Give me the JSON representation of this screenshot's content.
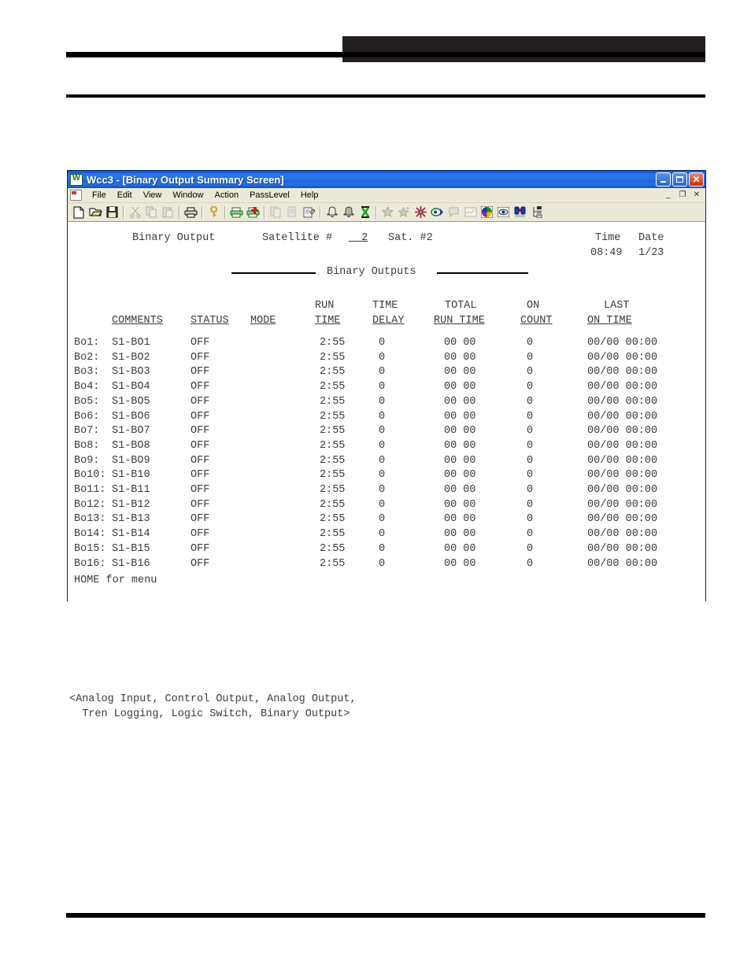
{
  "page": {
    "header_band_color": "#231f20",
    "rule_color": "#000000"
  },
  "window": {
    "title": "Wcc3 - [Binary Output Summary Screen]",
    "title_icon": "app-w-icon",
    "buttons": {
      "minimize": "_",
      "maximize": "□",
      "close": "✕"
    },
    "mdi_buttons": {
      "minimize": "_",
      "restore": "❐",
      "close": "✕"
    }
  },
  "menu": {
    "doc_icon": "document-icon",
    "items": [
      {
        "label": "File"
      },
      {
        "label": "Edit"
      },
      {
        "label": "View"
      },
      {
        "label": "Window"
      },
      {
        "label": "Action"
      },
      {
        "label": "PassLevel"
      },
      {
        "label": "Help"
      }
    ]
  },
  "toolbar": {
    "icons": [
      "new-document-icon",
      "open-folder-icon",
      "save-disk-icon",
      "cut-scissors-icon",
      "copy-icon",
      "paste-icon",
      "print-icon",
      "help-key-icon",
      "print-preview-icon",
      "print-report-icon",
      "copy-page-icon",
      "paste-page-icon",
      "edit-note-icon",
      "alarm-bell-icon",
      "alarm-bell-filled-icon",
      "hourglass-icon",
      "star-icon",
      "star-sparkle-icon",
      "firework-icon",
      "scan-eye-icon",
      "speech-bubble-icon",
      "trend-chart-icon",
      "pie-chart-icon",
      "eye-icon",
      "binoculars-icon",
      "tree-view-icon"
    ]
  },
  "screen": {
    "header": {
      "page_label": "Binary Output",
      "satellite_label": "Satellite #",
      "satellite_value": "__2",
      "sat_short": "Sat. #2",
      "time_label": "Time",
      "date_label": "Date",
      "time_value": "08:49",
      "date_value": "1/23",
      "section_title": "Binary Outputs"
    },
    "columns": {
      "top": [
        "",
        "",
        "",
        "RUN",
        "TIME",
        "TOTAL",
        "ON",
        "LAST"
      ],
      "bottom": [
        "COMMENTS",
        "STATUS",
        "MODE",
        "TIME",
        "DELAY",
        "RUN TIME",
        "COUNT",
        "ON TIME"
      ]
    },
    "rows": [
      {
        "id": "Bo1:",
        "comments": "S1-BO1",
        "status": "OFF",
        "mode": "",
        "run_time": "2:55",
        "time_delay": "0",
        "total_run_time": "00 00",
        "on_count": "0",
        "last_on_time": "00/00 00:00"
      },
      {
        "id": "Bo2:",
        "comments": "S1-BO2",
        "status": "OFF",
        "mode": "",
        "run_time": "2:55",
        "time_delay": "0",
        "total_run_time": "00 00",
        "on_count": "0",
        "last_on_time": "00/00 00:00"
      },
      {
        "id": "Bo3:",
        "comments": "S1-BO3",
        "status": "OFF",
        "mode": "",
        "run_time": "2:55",
        "time_delay": "0",
        "total_run_time": "00 00",
        "on_count": "0",
        "last_on_time": "00/00 00:00"
      },
      {
        "id": "Bo4:",
        "comments": "S1-BO4",
        "status": "OFF",
        "mode": "",
        "run_time": "2:55",
        "time_delay": "0",
        "total_run_time": "00 00",
        "on_count": "0",
        "last_on_time": "00/00 00:00"
      },
      {
        "id": "Bo5:",
        "comments": "S1-BO5",
        "status": "OFF",
        "mode": "",
        "run_time": "2:55",
        "time_delay": "0",
        "total_run_time": "00 00",
        "on_count": "0",
        "last_on_time": "00/00 00:00"
      },
      {
        "id": "Bo6:",
        "comments": "S1-BO6",
        "status": "OFF",
        "mode": "",
        "run_time": "2:55",
        "time_delay": "0",
        "total_run_time": "00 00",
        "on_count": "0",
        "last_on_time": "00/00 00:00"
      },
      {
        "id": "Bo7:",
        "comments": "S1-BO7",
        "status": "OFF",
        "mode": "",
        "run_time": "2:55",
        "time_delay": "0",
        "total_run_time": "00 00",
        "on_count": "0",
        "last_on_time": "00/00 00:00"
      },
      {
        "id": "Bo8:",
        "comments": "S1-BO8",
        "status": "OFF",
        "mode": "",
        "run_time": "2:55",
        "time_delay": "0",
        "total_run_time": "00 00",
        "on_count": "0",
        "last_on_time": "00/00 00:00"
      },
      {
        "id": "Bo9:",
        "comments": "S1-BO9",
        "status": "OFF",
        "mode": "",
        "run_time": "2:55",
        "time_delay": "0",
        "total_run_time": "00 00",
        "on_count": "0",
        "last_on_time": "00/00 00:00"
      },
      {
        "id": "Bo10:",
        "comments": "S1-B10",
        "status": "OFF",
        "mode": "",
        "run_time": "2:55",
        "time_delay": "0",
        "total_run_time": "00 00",
        "on_count": "0",
        "last_on_time": "00/00 00:00"
      },
      {
        "id": "Bo11:",
        "comments": "S1-B11",
        "status": "OFF",
        "mode": "",
        "run_time": "2:55",
        "time_delay": "0",
        "total_run_time": "00 00",
        "on_count": "0",
        "last_on_time": "00/00 00:00"
      },
      {
        "id": "Bo12:",
        "comments": "S1-B12",
        "status": "OFF",
        "mode": "",
        "run_time": "2:55",
        "time_delay": "0",
        "total_run_time": "00 00",
        "on_count": "0",
        "last_on_time": "00/00 00:00"
      },
      {
        "id": "Bo13:",
        "comments": "S1-B13",
        "status": "OFF",
        "mode": "",
        "run_time": "2:55",
        "time_delay": "0",
        "total_run_time": "00 00",
        "on_count": "0",
        "last_on_time": "00/00 00:00"
      },
      {
        "id": "Bo14:",
        "comments": "S1-B14",
        "status": "OFF",
        "mode": "",
        "run_time": "2:55",
        "time_delay": "0",
        "total_run_time": "00 00",
        "on_count": "0",
        "last_on_time": "00/00 00:00"
      },
      {
        "id": "Bo15:",
        "comments": "S1-B15",
        "status": "OFF",
        "mode": "",
        "run_time": "2:55",
        "time_delay": "0",
        "total_run_time": "00 00",
        "on_count": "0",
        "last_on_time": "00/00 00:00"
      },
      {
        "id": "Bo16:",
        "comments": "S1-B16",
        "status": "OFF",
        "mode": "",
        "run_time": "2:55",
        "time_delay": "0",
        "total_run_time": "00 00",
        "on_count": "0",
        "last_on_time": "00/00 00:00"
      }
    ],
    "status_hint": "HOME for menu"
  },
  "caption": {
    "line1": "<Analog Input, Control Output, Analog Output,",
    "line2": "  Tren Logging, Logic Switch, Binary Output>"
  }
}
